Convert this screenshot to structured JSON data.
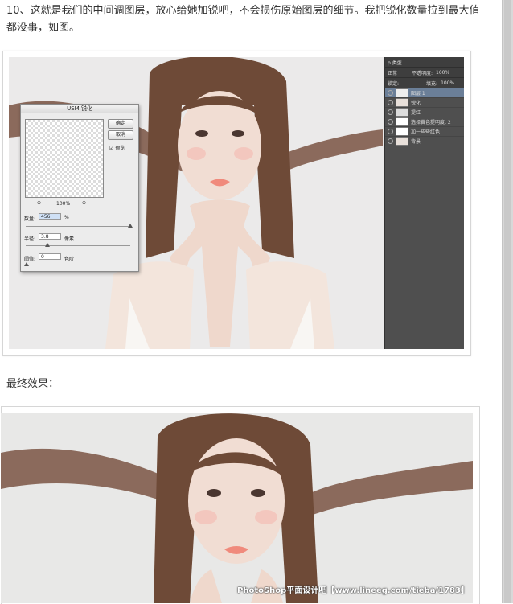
{
  "article": {
    "step_text": "10、这就是我们的中间调图层，放心给她加锐吧，不会损伤原始图层的细节。我把锐化数量拉到最大值都没事，如图。",
    "final_caption": "最终效果："
  },
  "usm_dialog": {
    "title": "USM 锐化",
    "ok": "确定",
    "cancel": "取消",
    "preview_label": "预览",
    "zoom": "100%",
    "amount_label": "数量:",
    "amount_value": "456",
    "amount_unit": "%",
    "radius_label": "半径:",
    "radius_value": "3.8",
    "radius_unit": "像素",
    "threshold_label": "阈值:",
    "threshold_value": "0",
    "threshold_unit": "色阶"
  },
  "layers_panel": {
    "kind_label": "ρ 类型",
    "blend_mode": "正常",
    "opacity_label": "不透明度:",
    "opacity_value": "100%",
    "lock_label": "锁定:",
    "fill_label": "填充:",
    "fill_value": "100%",
    "layers": [
      {
        "name": "图层 1",
        "selected": true
      },
      {
        "name": "锐化",
        "selected": false
      },
      {
        "name": "提红",
        "selected": false
      },
      {
        "name": "选择黄色提明度, 2",
        "selected": false
      },
      {
        "name": "加一些些红色",
        "selected": false
      },
      {
        "name": "背景",
        "selected": false
      }
    ]
  },
  "watermark": "PhotoShop平面设计吧【www.lineeg.com/tieba/1783】",
  "colors": {
    "selected_layer": "#6b7f98",
    "panel_bg": "#4f4f4f",
    "hair": "#6e4a37",
    "skin": "#f1ddd3",
    "lips": "#f08a7c"
  }
}
